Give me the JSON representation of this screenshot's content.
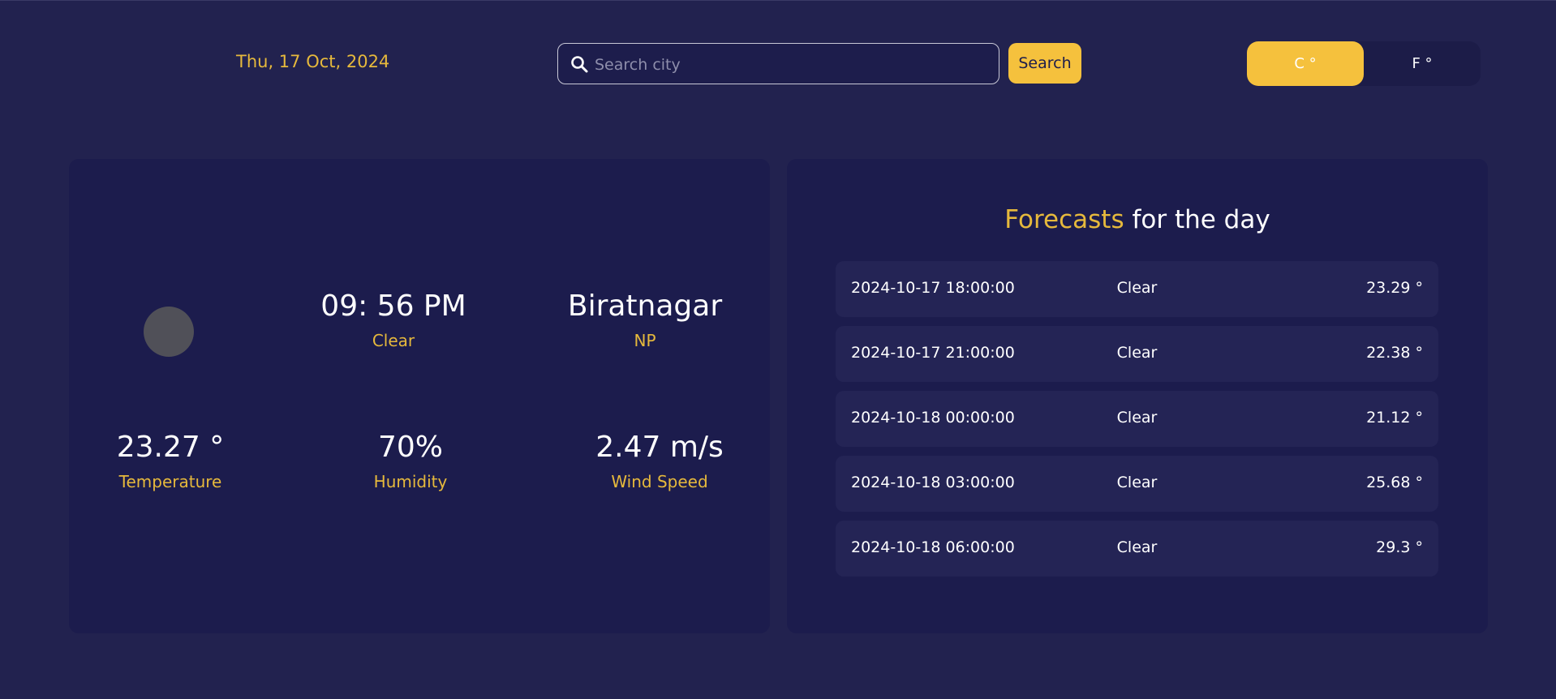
{
  "header": {
    "date": "Thu, 17 Oct, 2024",
    "search": {
      "placeholder": "Search city",
      "value": ""
    },
    "search_button": "Search",
    "unit_celsius": "C °",
    "unit_fahrenheit": "F °",
    "active_unit": "C °"
  },
  "current": {
    "icon": "weather-icon",
    "time": "09: 56 PM",
    "condition": "Clear",
    "city": "Biratnagar",
    "country": "NP",
    "temperature": "23.27 °",
    "temperature_label": "Temperature",
    "humidity": "70%",
    "humidity_label": "Humidity",
    "wind": "2.47 m/s",
    "wind_label": "Wind Speed"
  },
  "forecast": {
    "title_highlight": "Forecasts",
    "title_rest": " for the day",
    "items": [
      {
        "time": "2024-10-17 18:00:00",
        "condition": "Clear",
        "temp": "23.29 °"
      },
      {
        "time": "2024-10-17 21:00:00",
        "condition": "Clear",
        "temp": "22.38 °"
      },
      {
        "time": "2024-10-18 00:00:00",
        "condition": "Clear",
        "temp": "21.12 °"
      },
      {
        "time": "2024-10-18 03:00:00",
        "condition": "Clear",
        "temp": "25.68 °"
      },
      {
        "time": "2024-10-18 06:00:00",
        "condition": "Clear",
        "temp": "29.3 °"
      }
    ]
  },
  "colors": {
    "background": "#22224f",
    "card": "#1c1c4d",
    "accent": "#f5c13d",
    "accent_text": "#e6b93c"
  }
}
